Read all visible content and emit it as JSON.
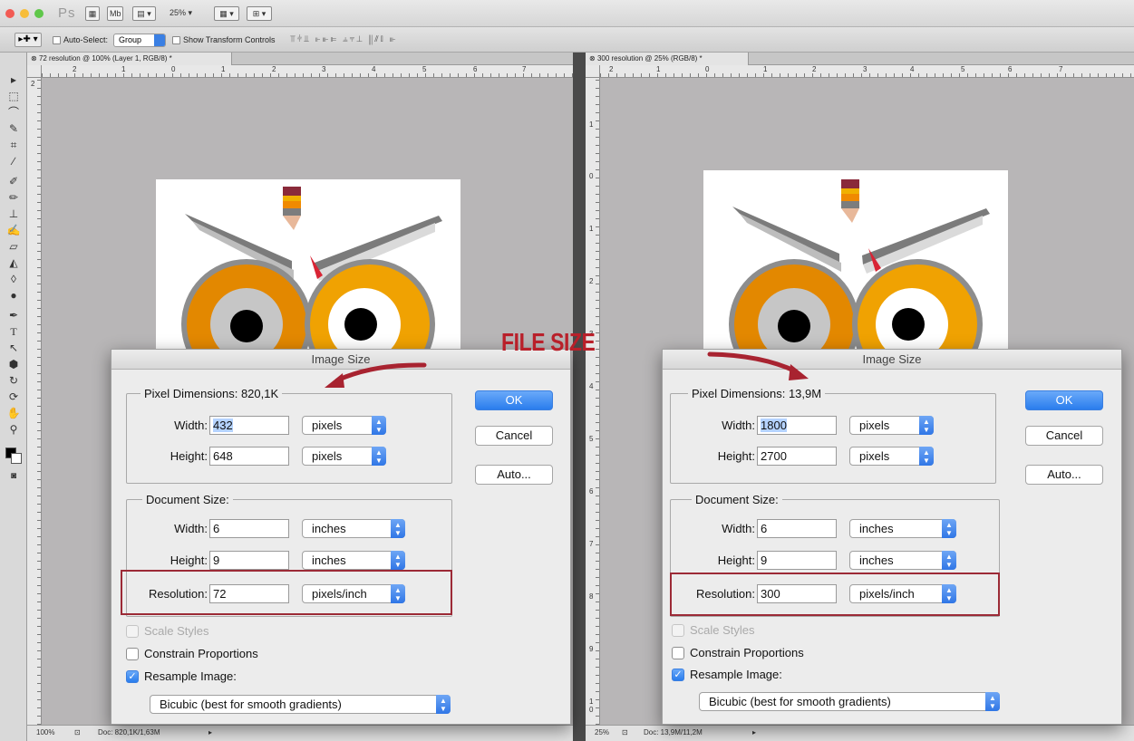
{
  "annotation": {
    "label": "FILE SIZE",
    "color": "#b9202a"
  },
  "menubar": {
    "app_logo": "Ps",
    "zoom": "25%"
  },
  "options_bar": {
    "auto_select_label": "Auto-Select:",
    "auto_select_value": "Group",
    "show_transform_label": "Show Transform Controls"
  },
  "docs": {
    "left": {
      "tab_title": "72 resolution @ 100% (Layer 1, RGB/8) *",
      "zoom": "100%",
      "doc_info": "Doc: 820,1K/1,63M",
      "ruler_h": [
        "2",
        "1",
        "0",
        "1",
        "2",
        "3",
        "4",
        "5",
        "6",
        "7"
      ],
      "ruler_v": [
        "2"
      ]
    },
    "right": {
      "tab_title": "300 resolution @ 25% (RGB/8) *",
      "zoom": "25%",
      "doc_info": "Doc: 13,9M/11,2M",
      "ruler_h": [
        "2",
        "1",
        "0",
        "1",
        "2",
        "3",
        "4",
        "5",
        "6",
        "7"
      ],
      "ruler_v": [
        "1",
        "0",
        "1",
        "2",
        "3",
        "4",
        "5",
        "6",
        "7",
        "8",
        "9",
        "1 0"
      ]
    }
  },
  "dialogs": {
    "left": {
      "title": "Image Size",
      "pixel_dimensions_label": "Pixel Dimensions:",
      "pixel_dimensions_value": "820,1K",
      "width_label": "Width:",
      "width_px": "432",
      "height_label": "Height:",
      "height_px": "648",
      "px_unit": "pixels",
      "document_size_label": "Document Size:",
      "doc_width": "6",
      "doc_height": "9",
      "doc_unit": "inches",
      "resolution_label": "Resolution:",
      "resolution": "72",
      "resolution_unit": "pixels/inch",
      "ok": "OK",
      "cancel": "Cancel",
      "auto": "Auto...",
      "scale_styles": "Scale Styles",
      "constrain": "Constrain Proportions",
      "resample": "Resample Image:",
      "resample_method": "Bicubic (best for smooth gradients)"
    },
    "right": {
      "title": "Image Size",
      "pixel_dimensions_label": "Pixel Dimensions:",
      "pixel_dimensions_value": "13,9M",
      "width_label": "Width:",
      "width_px": "1800",
      "height_label": "Height:",
      "height_px": "2700",
      "px_unit": "pixels",
      "document_size_label": "Document Size:",
      "doc_width": "6",
      "doc_height": "9",
      "doc_unit": "inches",
      "resolution_label": "Resolution:",
      "resolution": "300",
      "resolution_unit": "pixels/inch",
      "ok": "OK",
      "cancel": "Cancel",
      "auto": "Auto...",
      "scale_styles": "Scale Styles",
      "constrain": "Constrain Proportions",
      "resample": "Resample Image:",
      "resample_method": "Bicubic (best for smooth gradients)"
    }
  },
  "colors": {
    "accent_blue": "#2a7ded",
    "highlight_border": "#9c2a36",
    "owl_orange": "#f0a202",
    "owl_dark_orange": "#e38800"
  },
  "icons": [
    "move-tool-icon",
    "marquee-tool-icon",
    "lasso-tool-icon",
    "quick-select-icon",
    "crop-tool-icon",
    "eyedropper-icon",
    "healing-brush-icon",
    "brush-icon",
    "clone-stamp-icon",
    "history-brush-icon",
    "eraser-icon",
    "paint-bucket-icon",
    "blur-icon",
    "dodge-icon",
    "pen-icon",
    "type-icon",
    "path-select-icon",
    "shape-icon",
    "3d-rotate-icon",
    "3d-orbit-icon",
    "hand-icon",
    "zoom-icon"
  ]
}
